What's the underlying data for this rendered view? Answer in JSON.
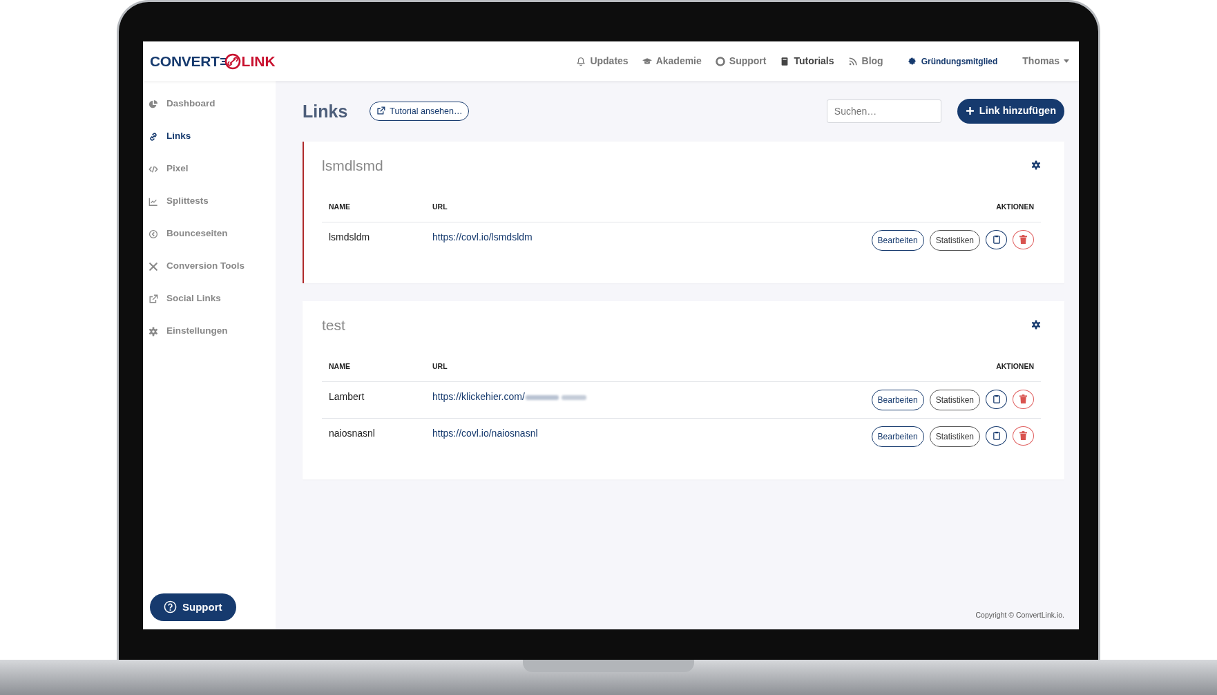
{
  "brand": {
    "left": "CONVERT",
    "right": "LINK"
  },
  "topnav": [
    {
      "label": "Updates",
      "selected": false
    },
    {
      "label": "Akademie",
      "selected": false
    },
    {
      "label": "Support",
      "selected": false
    },
    {
      "label": "Tutorials",
      "selected": true
    },
    {
      "label": "Blog",
      "selected": false
    }
  ],
  "member": {
    "label": "Gründungsmitglied"
  },
  "user": {
    "label": "Thomas"
  },
  "sidebar": [
    {
      "label": "Dashboard",
      "selected": false
    },
    {
      "label": "Links",
      "selected": true
    },
    {
      "label": "Pixel",
      "selected": false
    },
    {
      "label": "Splittests",
      "selected": false
    },
    {
      "label": "Bounceseiten",
      "selected": false
    },
    {
      "label": "Conversion Tools",
      "selected": false
    },
    {
      "label": "Social Links",
      "selected": false
    },
    {
      "label": "Einstellungen",
      "selected": false
    }
  ],
  "support_button": "Support",
  "page": {
    "title": "Links",
    "tutorial_button": "Tutorial ansehen…",
    "search": {
      "placeholder": "Suchen…"
    },
    "add_button": "Link hinzufügen"
  },
  "groups": [
    {
      "title": "lsmdlsmd",
      "highlighted": true,
      "columns": [
        "NAME",
        "URL",
        "AKTIONEN"
      ],
      "rows": [
        {
          "name": "lsmdsldm",
          "url": "https://covl.io/lsmdsldm",
          "redacted": false,
          "actions": [
            "Bearbeiten",
            "Statistiken"
          ]
        }
      ]
    },
    {
      "title": "test",
      "highlighted": false,
      "columns": [
        "NAME",
        "URL",
        "AKTIONEN"
      ],
      "rows": [
        {
          "name": "Lambert",
          "url": "https://klickehier.com/",
          "redacted": true,
          "actions": [
            "Bearbeiten",
            "Statistiken"
          ]
        },
        {
          "name": "naiosnasnl",
          "url": "https://covl.io/naiosnasnl",
          "redacted": false,
          "actions": [
            "Bearbeiten",
            "Statistiken"
          ]
        }
      ]
    }
  ],
  "footer": "Copyright © ConvertLink.io."
}
